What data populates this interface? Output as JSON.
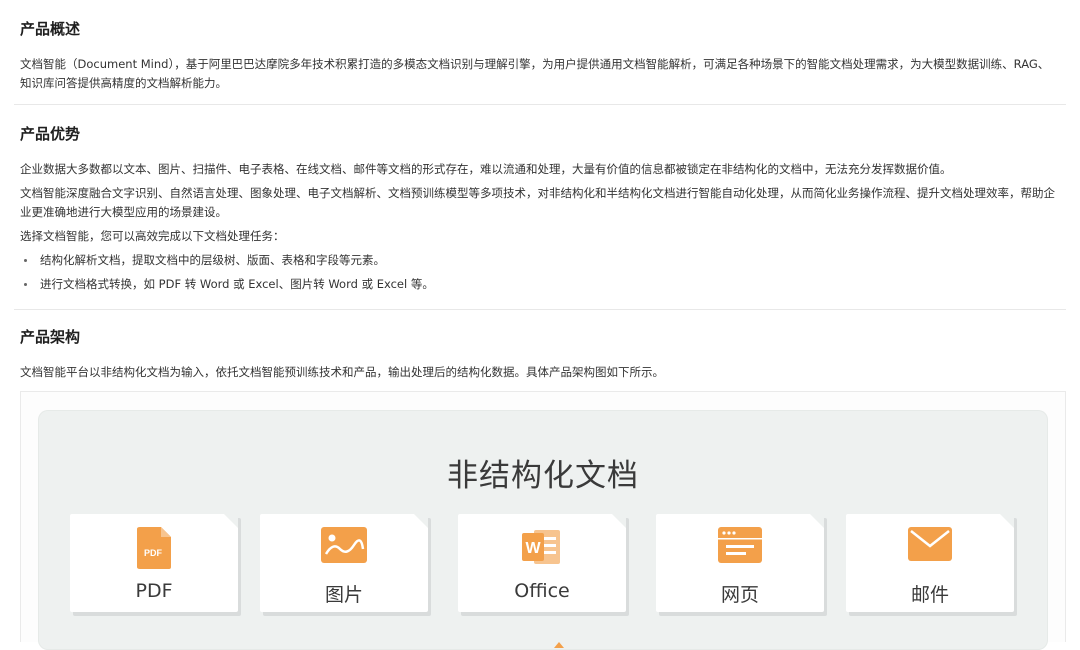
{
  "sections": {
    "overview": {
      "heading": "产品概述",
      "para": "文档智能（Document Mind），基于阿里巴巴达摩院多年技术积累打造的多模态文档识别与理解引擎，为用户提供通用文档智能解析，可满足各种场景下的智能文档处理需求，为大模型数据训练、RAG、知识库问答提供高精度的文档解析能力。"
    },
    "advantages": {
      "heading": "产品优势",
      "para1": "企业数据大多数都以文本、图片、扫描件、电子表格、在线文档、邮件等文档的形式存在，难以流通和处理，大量有价值的信息都被锁定在非结构化的文档中，无法充分发挥数据价值。",
      "para2": "文档智能深度融合文字识别、自然语言处理、图象处理、电子文档解析、文档预训练模型等多项技术，对非结构化和半结构化文档进行智能自动化处理，从而简化业务操作流程、提升文档处理效率，帮助企业更准确地进行大模型应用的场景建设。",
      "para3": "选择文档智能，您可以高效完成以下文档处理任务：",
      "bullets": [
        "结构化解析文档，提取文档中的层级树、版面、表格和字段等元素。",
        "进行文档格式转换，如 PDF 转 Word 或 Excel、图片转 Word 或 Excel 等。"
      ]
    },
    "architecture": {
      "heading": "产品架构",
      "para": "文档智能平台以非结构化文档为输入，依托文档智能预训练技术和产品，输出处理后的结构化数据。具体产品架构图如下所示。"
    }
  },
  "diagram": {
    "title": "非结构化文档",
    "accent": "#f3a04a",
    "cards": [
      {
        "label": "PDF",
        "icon": "pdf-file-icon",
        "icon_text": "PDF"
      },
      {
        "label": "图片",
        "icon": "image-icon"
      },
      {
        "label": "Office",
        "icon": "word-document-icon",
        "icon_text": "W"
      },
      {
        "label": "网页",
        "icon": "webpage-icon"
      },
      {
        "label": "邮件",
        "icon": "mail-icon"
      }
    ]
  }
}
